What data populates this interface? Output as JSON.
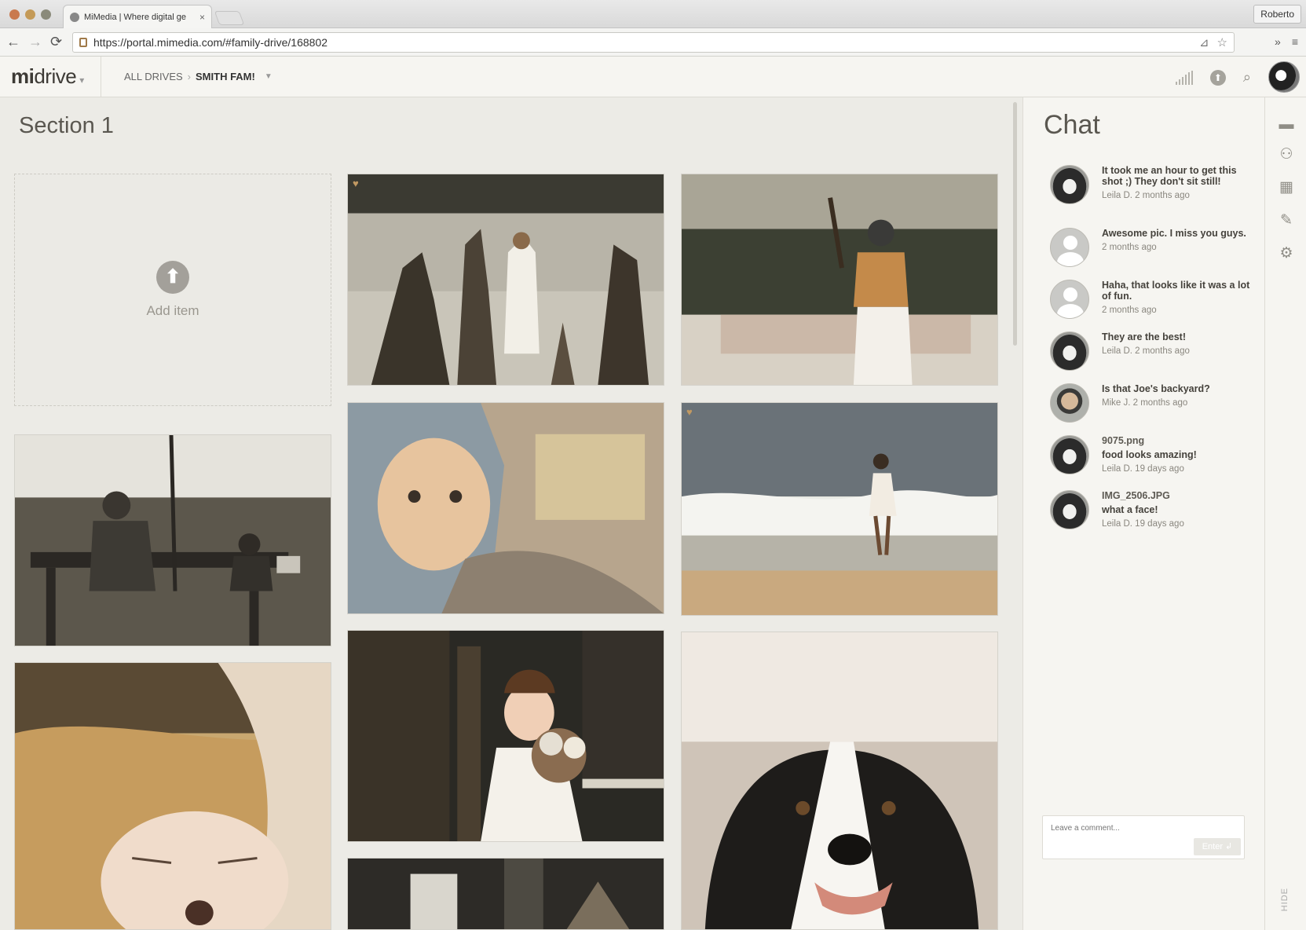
{
  "browser": {
    "tab_title": "MiMedia | Where digital ge",
    "tab_close": "×",
    "profile": "Roberto",
    "url": "https://portal.mimedia.com/#family-drive/168802",
    "back": "←",
    "forward": "→",
    "reload": "⟳",
    "extensions": "»",
    "menu": "≡"
  },
  "app": {
    "logo_light": "mi",
    "logo_rest": "drive",
    "breadcrumb": {
      "root": "ALL DRIVES",
      "separator": "›",
      "current": "SMITH FAM!"
    }
  },
  "main": {
    "section_title": "Section 1",
    "add_item_label": "Add item",
    "add_item_icon": "⬆"
  },
  "photos": [
    {
      "name": "photo-lake-girl",
      "favorite": true
    },
    {
      "name": "photo-baseball-boy",
      "favorite": false
    },
    {
      "name": "photo-park-bench",
      "favorite": false
    },
    {
      "name": "photo-baby-blanket",
      "favorite": false
    },
    {
      "name": "photo-beach-girl",
      "favorite": true
    },
    {
      "name": "photo-newborn",
      "favorite": false
    },
    {
      "name": "photo-flower-girl",
      "favorite": false
    },
    {
      "name": "photo-border-collie",
      "favorite": false
    },
    {
      "name": "photo-partial",
      "favorite": false
    }
  ],
  "chat": {
    "title": "Chat",
    "messages": [
      {
        "avatar": "dog",
        "file": "",
        "text": "It took me an hour to get this shot ;) They don't sit still!",
        "meta": "Leila D. 2 months ago"
      },
      {
        "avatar": "generic",
        "file": "",
        "text": "Awesome pic. I miss you guys.",
        "meta": "2 months ago"
      },
      {
        "avatar": "generic",
        "file": "",
        "text": "Haha, that looks like it was a lot of fun.",
        "meta": "2 months ago"
      },
      {
        "avatar": "dog",
        "file": "",
        "text": "They are the best!",
        "meta": "Leila D. 2 months ago"
      },
      {
        "avatar": "man",
        "file": "",
        "text": "Is that Joe's backyard?",
        "meta": "Mike J. 2 months ago"
      },
      {
        "avatar": "dog",
        "file": "9075.png",
        "text": "food looks amazing!",
        "meta": "Leila D. 19 days ago"
      },
      {
        "avatar": "dog",
        "file": "IMG_2506.JPG",
        "text": "what a face!",
        "meta": "Leila D. 19 days ago"
      }
    ],
    "comment_placeholder": "Leave a comment...",
    "enter_label": "Enter ↲"
  },
  "rail": {
    "hide_label": "HIDE"
  },
  "colors": {
    "accent": "#c19962",
    "background": "#ecebe6",
    "panel": "#f6f5f1"
  }
}
